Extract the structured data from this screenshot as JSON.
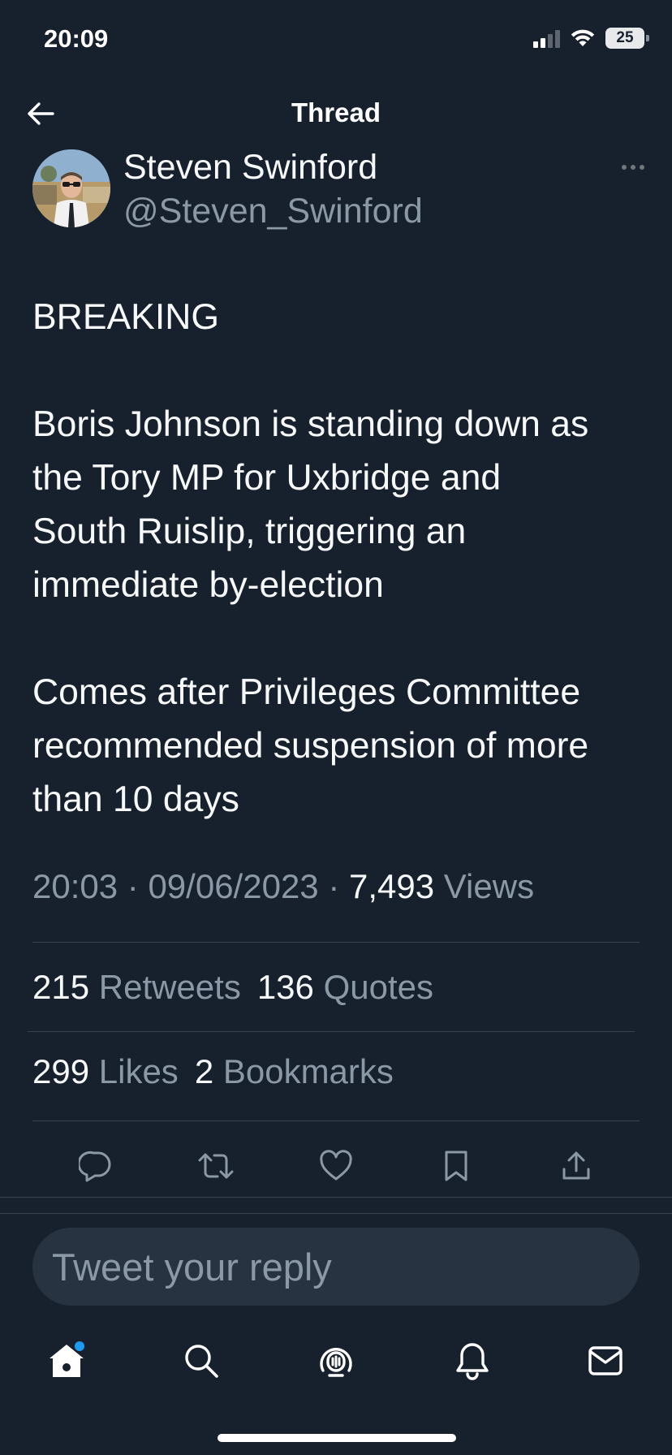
{
  "status_bar": {
    "time": "20:09",
    "battery": "25"
  },
  "header": {
    "title": "Thread"
  },
  "tweet": {
    "author_name": "Steven Swinford",
    "author_handle": "@Steven_Swinford",
    "paragraphs": {
      "p1": [
        "BREAKING"
      ],
      "p2": [
        "Boris Johnson is standing down as",
        "the Tory MP for Uxbridge and",
        "South Ruislip, triggering an",
        "immediate by-election"
      ],
      "p3": [
        "Comes after Privileges Committee",
        "recommended suspension of more",
        "than 10 days"
      ]
    },
    "time": "20:03",
    "date": "09/06/2023",
    "separator": "·",
    "views_count": "7,493",
    "views_label": "Views"
  },
  "stats": {
    "retweets": {
      "count": "215",
      "label": "Retweets"
    },
    "quotes": {
      "count": "136",
      "label": "Quotes"
    },
    "likes": {
      "count": "299",
      "label": "Likes"
    },
    "bookmarks": {
      "count": "2",
      "label": "Bookmarks"
    }
  },
  "actions": [
    "reply-icon",
    "retweet-icon",
    "like-icon",
    "bookmark-icon",
    "share-icon"
  ],
  "reply": {
    "placeholder": "Tweet your reply"
  },
  "tabs": [
    "home-icon",
    "search-icon",
    "spaces-icon",
    "notifications-icon",
    "messages-icon"
  ],
  "colors": {
    "background": "#17202d",
    "text": "#f7f9f9",
    "muted": "#8b98a5",
    "accent": "#1d9bf0",
    "divider": "#38444d"
  }
}
